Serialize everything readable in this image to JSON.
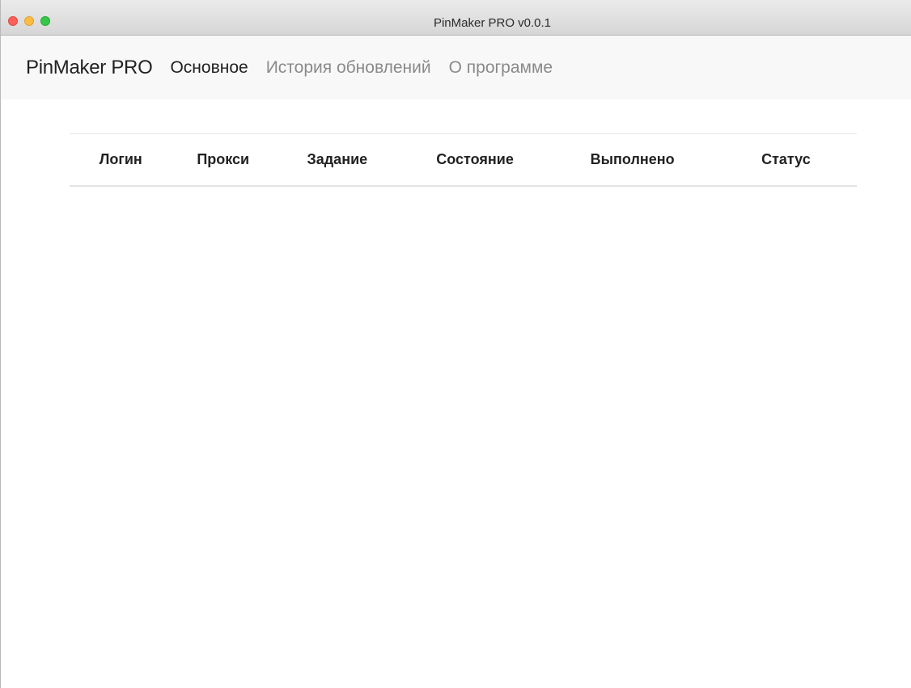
{
  "window": {
    "title": "PinMaker PRO v0.0.1"
  },
  "navbar": {
    "brand": "PinMaker PRO",
    "links": [
      {
        "label": "Основное",
        "active": true
      },
      {
        "label": "История обновлений",
        "active": false
      },
      {
        "label": "О программе",
        "active": false
      }
    ]
  },
  "table": {
    "columns": [
      "Логин",
      "Прокси",
      "Задание",
      "Состояние",
      "Выполнено",
      "Статус"
    ],
    "rows": []
  },
  "colors": {
    "close": "#fc605b",
    "minimize": "#fdbc40",
    "maximize": "#34c84a",
    "navbar_bg": "#f8f8f8",
    "active_link": "#1f1f1f",
    "inactive_link": "#8a8a8a"
  }
}
